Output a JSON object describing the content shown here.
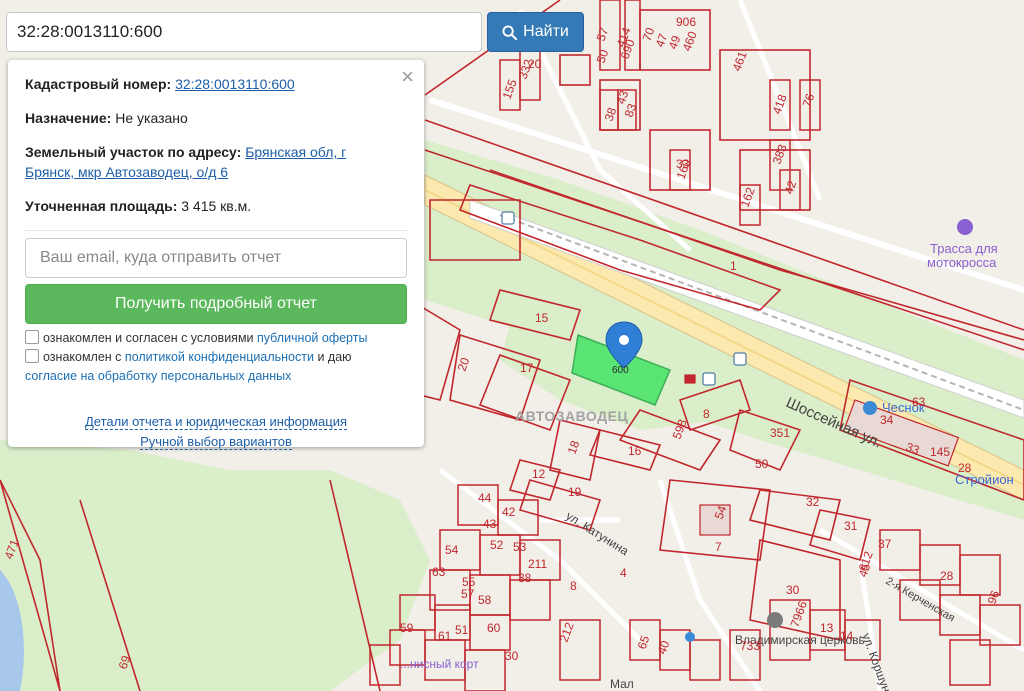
{
  "search": {
    "value": "32:28:0013110:600",
    "button_label": "Найти"
  },
  "info": {
    "cadastral_label": "Кадастровый номер:",
    "cadastral_value": "32:28:0013110:600",
    "purpose_label": "Назначение:",
    "purpose_value": "Не указано",
    "address_label": "Земельный участок по адресу:",
    "address_line1": "Брянская обл, г",
    "address_line2": "Брянск, мкр Автозаводец, о/д 6",
    "area_label": "Уточненная площадь:",
    "area_value": "3 415 кв.м.",
    "email_placeholder": "Ваш email, куда отправить отчет",
    "report_button": "Получить подробный отчет",
    "agree1_text": "ознакомлен и согласен с условиями",
    "agree1_link": "публичной оферты",
    "agree2_text": "ознакомлен с",
    "agree2_link": "политикой конфиденциальности",
    "agree2_mid": "и даю",
    "agree2_link2": "согласие на обработку персональных данных",
    "details_link": "Детали отчета и юридическая информация",
    "manual_link": "Ручной выбор вариантов",
    "close_symbol": "×"
  },
  "map": {
    "district": "АВТОЗАВОДЕЦ",
    "street_shosseynaya": "Шоссейная ул.",
    "street_katunina": "ул. Катунина",
    "street_korshunova": "ул. Коршунова",
    "street_kerchenskaya": "2-я Керченская",
    "street_maly": "Мал",
    "poi_track_1": "Трасса для",
    "poi_track_2": "мотокросса",
    "poi_chesnok": "Чеснок",
    "poi_stroyion": "Стройион",
    "poi_church": "Владимирская церковь",
    "poi_sport": "...нисный корт",
    "selected_parcel_label": "600",
    "parcel_numbers": [
      "906",
      "70",
      "47",
      "49",
      "460",
      "57",
      "414",
      "20",
      "690",
      "50",
      "461",
      "155",
      "332",
      "43",
      "38",
      "83",
      "76",
      "418",
      "33",
      "160",
      "383",
      "42",
      "162",
      "1",
      "15",
      "20",
      "17",
      "598",
      "8",
      "18",
      "16",
      "12",
      "19",
      "44",
      "42",
      "43",
      "52",
      "53",
      "54",
      "63",
      "55",
      "57",
      "58",
      "59",
      "61",
      "51",
      "60",
      "38",
      "211",
      "212",
      "351",
      "50",
      "63",
      "34",
      "33",
      "145",
      "28",
      "32",
      "31",
      "37",
      "612",
      "30",
      "45",
      "28",
      "96",
      "54",
      "7",
      "7966",
      "13",
      "14",
      "4",
      "8",
      "65",
      "40",
      "30",
      "733",
      "471",
      "69"
    ]
  },
  "colors": {
    "parcel_line": "#c1272d",
    "selected_fill": "#4ce36a",
    "pin": "#2f7fd6",
    "park": "#d9eec9",
    "road": "#ffffff",
    "rail": "#b5b5b5",
    "water": "#a8c8eb",
    "poi": "#8a5fcf"
  }
}
